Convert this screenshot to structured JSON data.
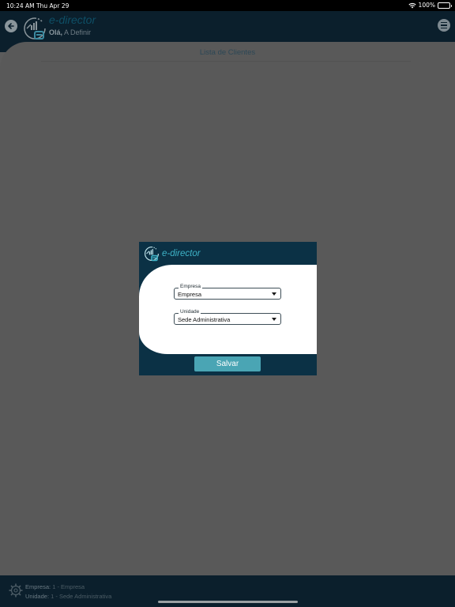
{
  "status_bar": {
    "time": "10:24 AM",
    "date": "Thu Apr 29",
    "battery": "100%",
    "battery_level": 1.0
  },
  "header": {
    "brand": "e-director",
    "greeting_prefix": "Olá,",
    "greeting_name": "A Definir",
    "back_icon": "arrow-left-icon",
    "menu_icon": "hamburger-menu-icon"
  },
  "main": {
    "title": "Lista de Clientes"
  },
  "modal": {
    "brand": "e-director",
    "empresa": {
      "label": "Empresa",
      "value": "Empresa"
    },
    "unidade": {
      "label": "Unidade",
      "value": "Sede Administrativa"
    },
    "save_label": "Salvar"
  },
  "footer": {
    "empresa_label": "Empresa:",
    "empresa_value": "1 - Empresa",
    "unidade_label": "Unidade:",
    "unidade_value": "1 - Sede Administrativa"
  },
  "colors": {
    "header_bg": "#0b1f2c",
    "overlay": "#5c5c5c",
    "modal_dark": "#0b3145",
    "accent": "#4aa5b4"
  }
}
